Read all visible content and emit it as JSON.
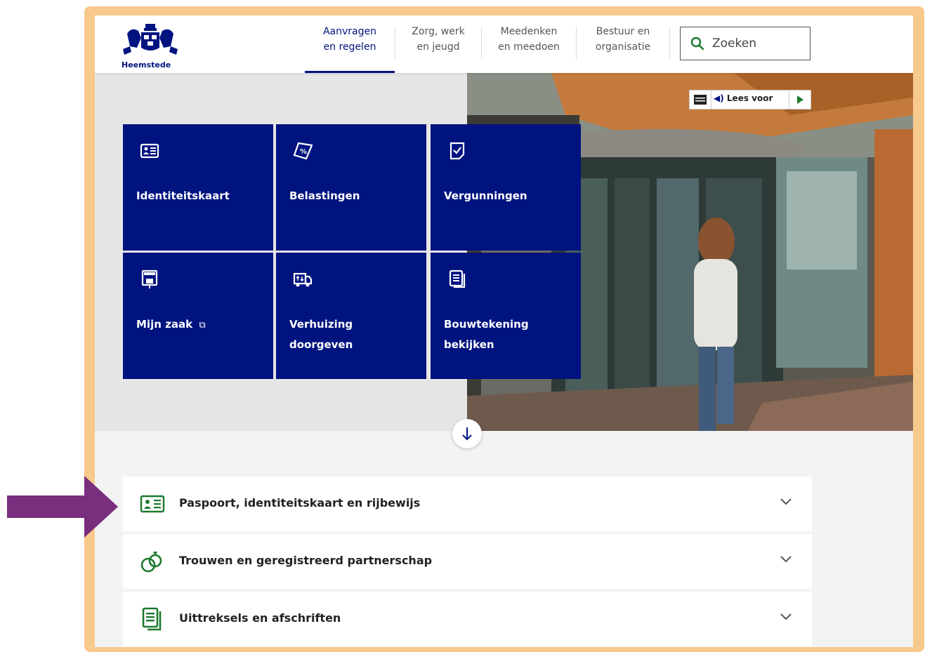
{
  "brand": {
    "name": "Heemstede"
  },
  "nav": {
    "items": [
      {
        "line1": "Aanvragen",
        "line2": "en regelen",
        "active": true
      },
      {
        "line1": "Zorg, werk",
        "line2": "en jeugd",
        "active": false
      },
      {
        "line1": "Meedenken",
        "line2": "en meedoen",
        "active": false
      },
      {
        "line1": "Bestuur en",
        "line2": "organisatie",
        "active": false
      }
    ]
  },
  "search": {
    "label": "Zoeken",
    "icon": "search-icon"
  },
  "readspeaker": {
    "label": "Lees voor",
    "menu_icon": "menu-icon",
    "speaker_icon": "speaker-icon",
    "play_icon": "play-icon"
  },
  "tiles": [
    {
      "label": "Identiteitskaart",
      "icon": "id-card-icon"
    },
    {
      "label": "Belastingen",
      "icon": "tax-icon"
    },
    {
      "label": "Vergunningen",
      "icon": "permit-checklist-icon"
    },
    {
      "label": "Mijn zaak",
      "icon": "welcome-sign-icon",
      "external": true
    },
    {
      "label": "Verhuizing doorgeven",
      "icon": "moving-truck-icon"
    },
    {
      "label": "Bouwtekening bekijken",
      "icon": "documents-icon"
    }
  ],
  "scroll_button": {
    "icon": "arrow-down-icon"
  },
  "accordion": [
    {
      "label": "Paspoort, identiteitskaart en rijbewijs",
      "icon": "id-card-icon"
    },
    {
      "label": "Trouwen en geregistreerd partnerschap",
      "icon": "wedding-rings-icon"
    },
    {
      "label": "Uittreksels en afschriften",
      "icon": "documents-icon"
    }
  ],
  "colors": {
    "brand_blue": "#00137f",
    "accordion_icon_green": "#1b7a2e",
    "frame_orange": "#f8c98d",
    "arrow_purple": "#7a2e7e"
  }
}
